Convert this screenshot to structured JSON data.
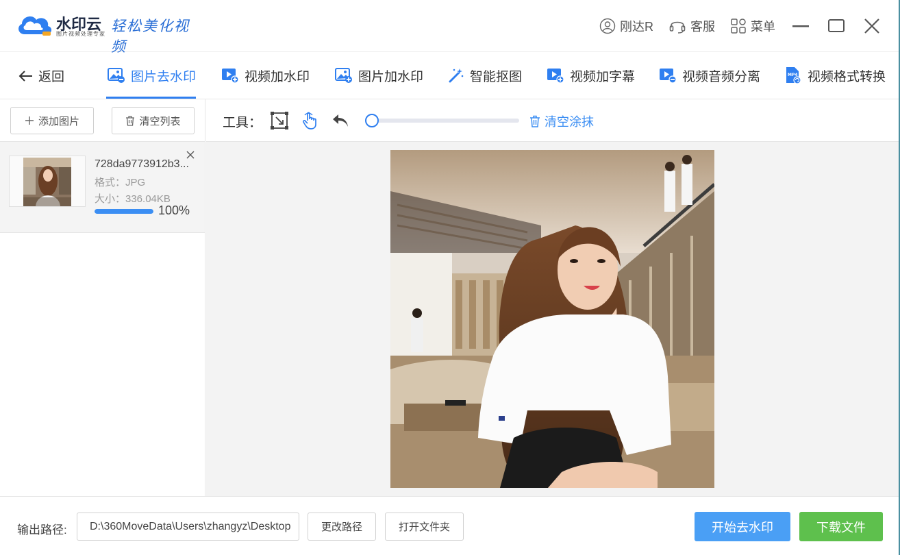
{
  "app": {
    "name": "水印云",
    "subtitle": "图片视频处理专家",
    "slogan": "轻松美化视频",
    "brand_color": "#2f7ff0"
  },
  "titlebar": {
    "user": "刚达R",
    "service": "客服",
    "menu": "菜单",
    "icons": [
      "user-circle-icon",
      "headset-icon",
      "grid-menu-icon",
      "minimize-icon",
      "maximize-icon",
      "close-icon"
    ]
  },
  "tabs": {
    "back": "返回",
    "items": [
      {
        "label": "图片去水印",
        "icon": "image-remove-icon",
        "active": true
      },
      {
        "label": "视频加水印",
        "icon": "video-add-icon",
        "active": false
      },
      {
        "label": "图片加水印",
        "icon": "image-add-icon",
        "active": false
      },
      {
        "label": "智能抠图",
        "icon": "magic-wand-icon",
        "active": false
      },
      {
        "label": "视频加字幕",
        "icon": "video-subtitle-icon",
        "active": false
      },
      {
        "label": "视频音频分离",
        "icon": "video-audio-split-icon",
        "active": false
      },
      {
        "label": "视频格式转换",
        "icon": "mp4-convert-icon",
        "active": false
      }
    ]
  },
  "sidebar": {
    "add_label": "添加图片",
    "clear_label": "清空列表",
    "files": [
      {
        "name": "728da9773912b3...",
        "format": "格式：JPG",
        "size": "大小：336.04KB",
        "progress": 1.0,
        "progress_text": "100%"
      }
    ]
  },
  "editor": {
    "tools_label": "工具：",
    "tool_icons": [
      "select-box-icon",
      "hand-pointer-icon",
      "undo-arrow-icon"
    ],
    "brush_size": 0.0,
    "clear_smear": "清空涂抹",
    "accent": "#3b8ef3"
  },
  "bottom": {
    "output_label": "输出路径:",
    "output_path": "D:\\360MoveData\\Users\\zhangyz\\Desktop",
    "change_path": "更改路径",
    "open_folder": "打开文件夹",
    "start": "开始去水印",
    "download": "下载文件",
    "start_color": "#4a9ff5",
    "download_color": "#5ec04d"
  }
}
